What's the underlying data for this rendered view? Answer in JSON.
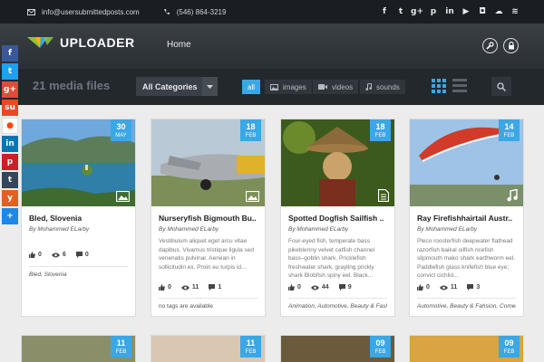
{
  "topbar": {
    "email": "info@usersubmittedposts.com",
    "phone": "(546) 864-3219"
  },
  "social_icons": [
    {
      "name": "facebook-icon",
      "glyph": "f"
    },
    {
      "name": "twitter-icon",
      "glyph": "t"
    },
    {
      "name": "google-plus-icon",
      "glyph": "g+"
    },
    {
      "name": "pinterest-icon",
      "glyph": "p"
    },
    {
      "name": "linkedin-icon",
      "glyph": "in"
    },
    {
      "name": "youtube-icon",
      "glyph": "▶"
    },
    {
      "name": "instagram-icon",
      "glyph": "◘"
    },
    {
      "name": "soundcloud-icon",
      "glyph": "☁"
    },
    {
      "name": "rss-icon",
      "glyph": "≋"
    }
  ],
  "header": {
    "logo_text": "UPLOADER",
    "nav_home": "Home"
  },
  "filterbar": {
    "count": "21 media files",
    "category": "All Categories",
    "tabs": {
      "all": "all",
      "images": "images",
      "videos": "videos",
      "sounds": "sounds"
    }
  },
  "share_buttons": [
    {
      "name": "facebook-share-icon",
      "glyph": "f",
      "color": "#3b5998"
    },
    {
      "name": "twitter-share-icon",
      "glyph": "t",
      "color": "#1da1f2"
    },
    {
      "name": "google-plus-share-icon",
      "glyph": "g+",
      "color": "#dd4b39"
    },
    {
      "name": "stumbleupon-share-icon",
      "glyph": "su",
      "color": "#eb4924"
    },
    {
      "name": "reddit-share-icon",
      "glyph": "●",
      "color": "#ffffff"
    },
    {
      "name": "linkedin-share-icon",
      "glyph": "in",
      "color": "#0077b5"
    },
    {
      "name": "pinterest-share-icon",
      "glyph": "p",
      "color": "#cb2027"
    },
    {
      "name": "tumblr-share-icon",
      "glyph": "t",
      "color": "#35465c"
    },
    {
      "name": "yummly-share-icon",
      "glyph": "y",
      "color": "#e16120"
    },
    {
      "name": "share-icon",
      "glyph": "+",
      "color": "#1e88e5"
    }
  ],
  "cards": [
    {
      "day": "30",
      "month": "MAY",
      "title": "Bled, Slovenia",
      "author_prefix": "By",
      "author": "Mohammed ELarby",
      "desc": "",
      "stat1": "0",
      "stat2": "6",
      "stat3": "0",
      "tags": "Bled, Slovenia",
      "type": "image"
    },
    {
      "day": "18",
      "month": "FEB",
      "title": "Nurseryfish Bigmouth Bu..",
      "author_prefix": "By",
      "author": "Mohammed ELarby",
      "desc": "Vestibulum aliquet eget arcu vitae dapibus. Vivamus tristique ligula sed venenatis pulvinar. Aenean in sollicitudin ex. Proin eu turpis id...",
      "stat1": "0",
      "stat2": "11",
      "stat3": "1",
      "tags": "no tags are available",
      "type": "image"
    },
    {
      "day": "18",
      "month": "FEB",
      "title": "Spotted Dogfish Sailfish ..",
      "author_prefix": "By",
      "author": "Mohammed ELarby",
      "desc": "Four-eyed fish, temperate bass pikeblenny velvet catfish channel bass–goblin shark. Pricklefish freshwater shark, grayling prickly shark Blobfish spiny eel. Black...",
      "stat1": "0",
      "stat2": "44",
      "stat3": "9",
      "tags": "Animation, Automotive, Beauty & Fashion",
      "type": "document"
    },
    {
      "day": "14",
      "month": "FEB",
      "title": "Ray Firefishhairtail Austr..",
      "author_prefix": "By",
      "author": "Mohammed ELarby",
      "desc": "Pleco roosterfish deepwater flathead razorfish baikal oilfish ricefish slipmouth mako shark earthworm eel. Paddlefish glass knifefish blue eye; convict cichlid...",
      "stat1": "0",
      "stat2": "11",
      "stat3": "3",
      "tags": "Automotive, Beauty & Fahsion, Comedy",
      "type": "sound"
    }
  ],
  "cards_row2": [
    {
      "day": "11",
      "month": "FEB"
    },
    {
      "day": "11",
      "month": "FEB"
    },
    {
      "day": "09",
      "month": "FEB"
    },
    {
      "day": "09",
      "month": "FEB"
    }
  ],
  "colors": {
    "accent": "#3aa7e6",
    "topbar": "#1a1d21",
    "header": "#2e3338",
    "filterbar": "#23282d",
    "page": "#ececec"
  }
}
